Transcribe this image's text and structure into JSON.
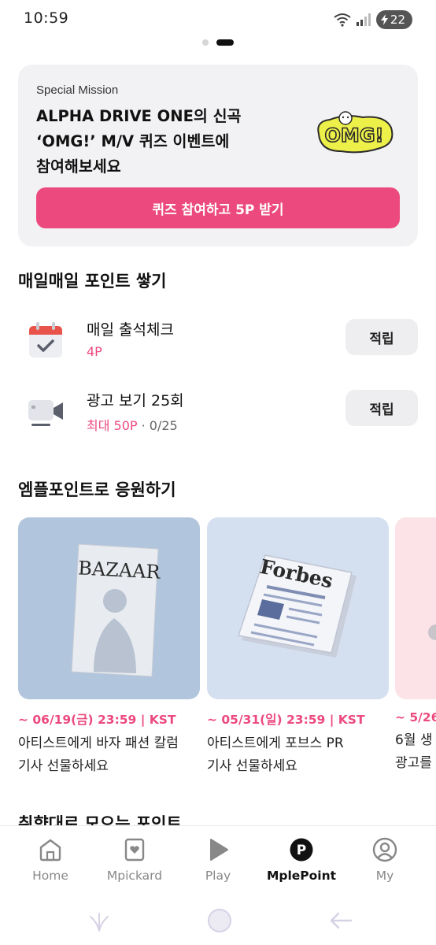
{
  "status_bar": {
    "time": "10:59",
    "battery": "22"
  },
  "pager": {
    "count": 2,
    "active_index": 1
  },
  "mission": {
    "eyebrow": "Special Mission",
    "title_lines": [
      "ALPHA DRIVE ONE의 신곡",
      "‘OMG!’ M/V 퀴즈 이벤트에",
      "참여해보세요"
    ],
    "art_text": "OMG!",
    "button_label": "퀴즈 참여하고 5P 받기"
  },
  "daily": {
    "section_title": "매일매일 포인트 쌓기",
    "items": [
      {
        "icon": "calendar-check-icon",
        "title": "매일 출석체크",
        "reward": "4P",
        "extra": "",
        "button_label": "적립"
      },
      {
        "icon": "video-camera-icon",
        "title": "광고 보기 25회",
        "reward": "최대 50P",
        "extra": " · 0/25",
        "button_label": "적립"
      }
    ]
  },
  "support": {
    "section_title": "엠플포인트로 응원하기",
    "cards": [
      {
        "image": "bazaar-magazine-image",
        "art_text": "BAZAAR",
        "date": "~ 06/19(금) 23:59 | KST",
        "desc_lines": [
          "아티스트에게 바자 패션 칼럼",
          "기사 선물하세요"
        ]
      },
      {
        "image": "forbes-newspaper-image",
        "art_text": "Forbes",
        "date": "~ 05/31(일) 23:59 | KST",
        "desc_lines": [
          "아티스트에게 포브스 PR",
          "기사 선물하세요"
        ]
      },
      {
        "image": "promo-image",
        "art_text": "",
        "date": "~ 5/26",
        "desc_lines": [
          "6월 생",
          "광고를"
        ]
      }
    ]
  },
  "next_section_title": "취향대로 모으는 포인트",
  "bottom_nav": {
    "items": [
      {
        "label": "Home",
        "icon": "home-icon",
        "active": false
      },
      {
        "label": "Mpickard",
        "icon": "heart-card-icon",
        "active": false
      },
      {
        "label": "Play",
        "icon": "play-icon",
        "active": false
      },
      {
        "label": "MplePoint",
        "icon": "point-icon",
        "active": true
      },
      {
        "label": "My",
        "icon": "profile-icon",
        "active": false
      }
    ]
  },
  "colors": {
    "accent": "#ec4a7e",
    "card_bg": "#f2f2f4",
    "bazaar_bg": "#b1c5dc",
    "forbes_bg": "#d4dff0",
    "third_bg": "#fbe3e8"
  }
}
